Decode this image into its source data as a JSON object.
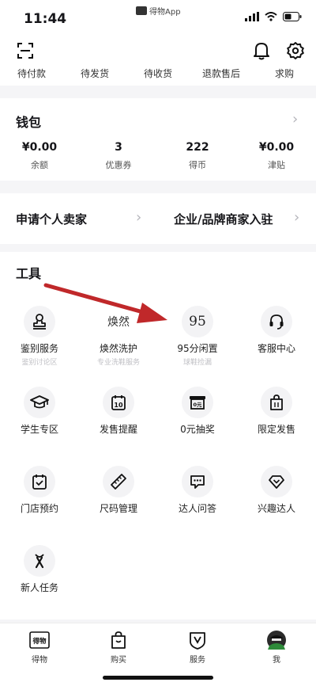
{
  "status": {
    "time": "11:44",
    "app_name": "得物App",
    "logo_text": "得物"
  },
  "orders": [
    "待付款",
    "待发货",
    "待收货",
    "退款售后",
    "求购"
  ],
  "wallet": {
    "title": "钱包",
    "items": [
      {
        "value": "¥0.00",
        "label": "余额"
      },
      {
        "value": "3",
        "label": "优惠券"
      },
      {
        "value": "222",
        "label": "得币"
      },
      {
        "value": "¥0.00",
        "label": "津贴"
      }
    ]
  },
  "apply": {
    "personal": "申请个人卖家",
    "enterprise": "企业/品牌商家入驻"
  },
  "tools": {
    "title": "工具",
    "items": [
      {
        "label": "鉴别服务",
        "sub": "鉴别讨论区",
        "icon": "seal-stamp-icon"
      },
      {
        "label": "焕然洗护",
        "sub": "专业洗鞋服务",
        "icon": "huanran-logo",
        "icon_text": "焕然"
      },
      {
        "label": "95分闲置",
        "sub": "球鞋捡漏",
        "icon": "95-logo",
        "icon_text": "95"
      },
      {
        "label": "客服中心",
        "sub": "",
        "icon": "headset-icon"
      },
      {
        "label": "学生专区",
        "sub": "",
        "icon": "graduation-cap-icon"
      },
      {
        "label": "发售提醒",
        "sub": "",
        "icon": "calendar-icon",
        "icon_text": "10"
      },
      {
        "label": "0元抽奖",
        "sub": "",
        "icon": "lottery-ticket-icon",
        "icon_text": "0元"
      },
      {
        "label": "限定发售",
        "sub": "",
        "icon": "shopping-bag-icon"
      },
      {
        "label": "门店预约",
        "sub": "",
        "icon": "calendar-check-icon"
      },
      {
        "label": "尺码管理",
        "sub": "",
        "icon": "ruler-icon"
      },
      {
        "label": "达人问答",
        "sub": "",
        "icon": "chat-bubble-icon"
      },
      {
        "label": "兴趣达人",
        "sub": "",
        "icon": "gem-icon"
      },
      {
        "label": "新人任务",
        "sub": "",
        "icon": "ribbon-icon"
      }
    ]
  },
  "tabbar": [
    {
      "label": "得物",
      "icon": "dewu-logo-icon",
      "icon_text": "得物"
    },
    {
      "label": "购买",
      "icon": "bag-icon"
    },
    {
      "label": "服务",
      "icon": "shield-v-icon"
    },
    {
      "label": "我",
      "icon": "avatar-icon"
    }
  ],
  "colors": {
    "arrow": "#c0282a",
    "accent_dark": "#16161a",
    "chevron": "#b5b5bb"
  }
}
